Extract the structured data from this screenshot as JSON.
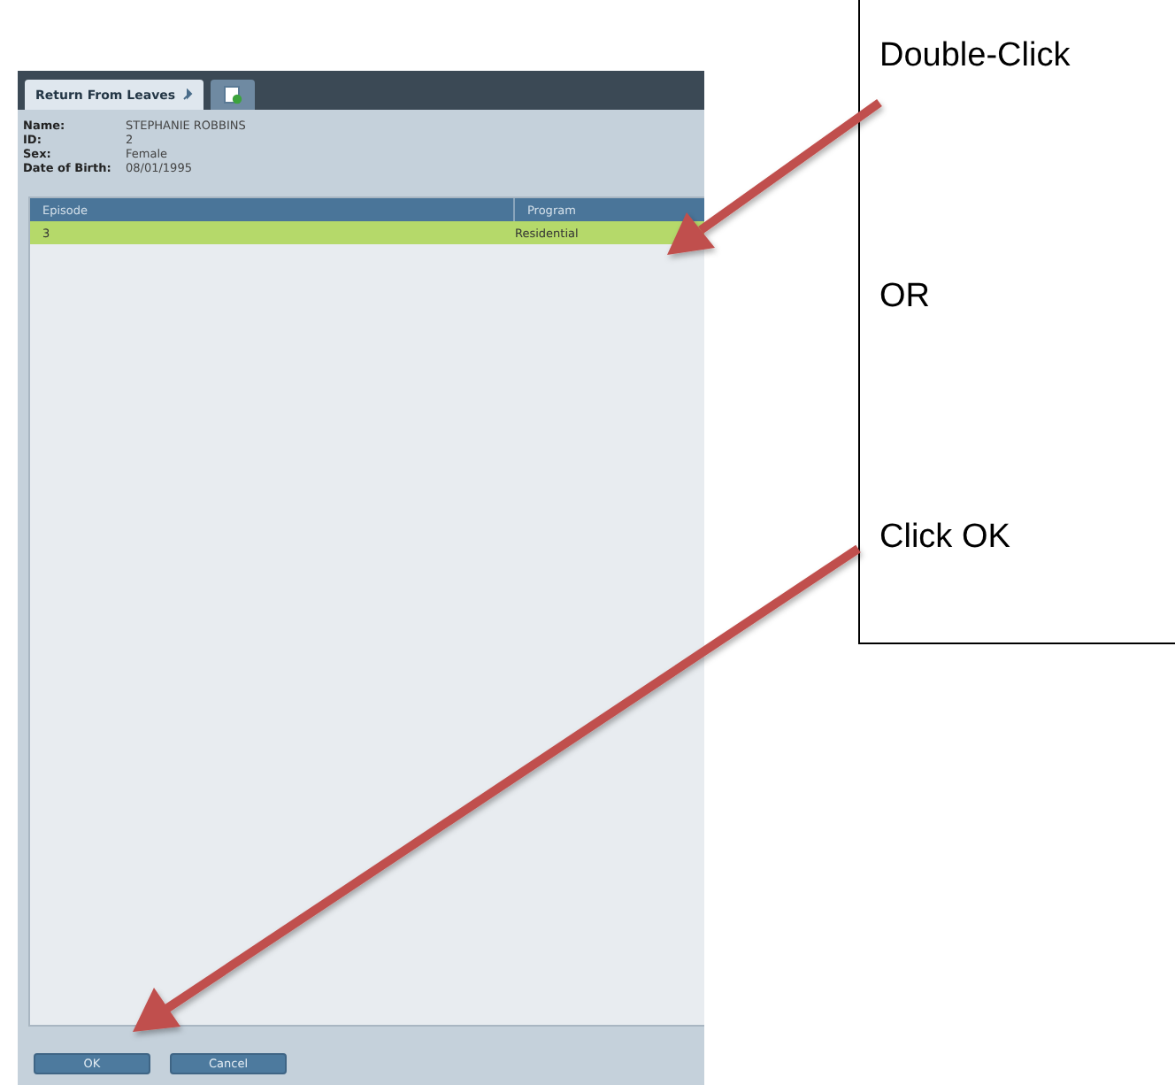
{
  "tabs": [
    {
      "kind": "text",
      "label": "Return From Leaves",
      "selected": true
    },
    {
      "kind": "icon",
      "selected": false
    }
  ],
  "patient": [
    {
      "label": "Name:",
      "value": "STEPHANIE ROBBINS"
    },
    {
      "label": "ID:",
      "value": "2"
    },
    {
      "label": "Sex:",
      "value": "Female"
    },
    {
      "label": "Date of Birth:",
      "value": "08/01/1995"
    }
  ],
  "table": {
    "columns": [
      "Episode",
      "Program"
    ],
    "rows": [
      {
        "cells": [
          "3",
          "Residential"
        ],
        "selected": true
      }
    ]
  },
  "buttons": [
    "OK",
    "Cancel"
  ],
  "callout": {
    "lines": [
      "Double-Click",
      "OR",
      "Click OK"
    ]
  }
}
